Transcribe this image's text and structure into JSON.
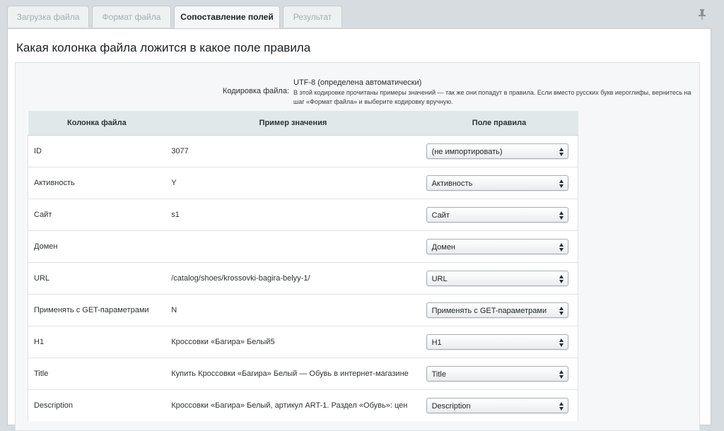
{
  "tabs": [
    {
      "label": "Загрузка файла",
      "active": false
    },
    {
      "label": "Формат файла",
      "active": false
    },
    {
      "label": "Сопоставление полей",
      "active": true
    },
    {
      "label": "Результат",
      "active": false
    }
  ],
  "page_title": "Какая колонка файла ложится в какое поле правила",
  "encoding": {
    "label": "Кодировка файла:",
    "value": "UTF-8 (определена автоматически)",
    "note": "В этой кодировке прочитаны примеры значений — так же они попадут в правила. Если вместо русских букв иероглифы, вернитесь на шаг «Формат файла» и выберите кодировку вручную."
  },
  "table": {
    "headers": [
      "Колонка файла",
      "Пример значения",
      "Поле правила"
    ],
    "rows": [
      {
        "column": "ID",
        "sample": "3077",
        "field": "(не импортировать)"
      },
      {
        "column": "Активность",
        "sample": "Y",
        "field": "Активность"
      },
      {
        "column": "Сайт",
        "sample": "s1",
        "field": "Сайт"
      },
      {
        "column": "Домен",
        "sample": "",
        "field": "Домен"
      },
      {
        "column": "URL",
        "sample": "/catalog/shoes/krossovki-bagira-belyy-1/",
        "field": "URL"
      },
      {
        "column": "Применять с GET-параметрами",
        "sample": "N",
        "field": "Применять с GET-параметрами"
      },
      {
        "column": "H1",
        "sample": "Кроссовки «Багира» Белый5",
        "field": "H1"
      },
      {
        "column": "Title",
        "sample": "Купить Кроссовки «Багира» Белый — Обувь в интернет-магазине",
        "field": "Title"
      },
      {
        "column": "Description",
        "sample": "Кроссовки «Багира» Белый, артикул ART-1. Раздел «Обувь»: цен",
        "field": "Description"
      }
    ]
  },
  "icons": {
    "pin": "pin-icon",
    "select_arrows": "select-arrows-icon"
  }
}
